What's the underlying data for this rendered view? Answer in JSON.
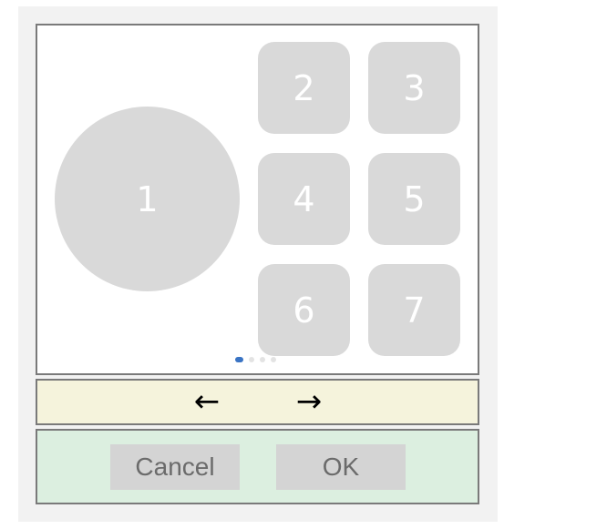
{
  "grid": {
    "circle_label": "1",
    "tiles": [
      "2",
      "3",
      "4",
      "5",
      "6",
      "7"
    ]
  },
  "pager": {
    "count": 4,
    "active_index": 0,
    "active_color": "#3a74c4"
  },
  "navigation": {
    "prev_symbol": "←",
    "next_symbol": "→",
    "prev_icon": "arrow-left-icon",
    "next_icon": "arrow-right-icon"
  },
  "actions": {
    "cancel_label": "Cancel",
    "ok_label": "OK"
  },
  "colors": {
    "nav_bar_bg": "#f5f3dc",
    "action_bar_bg": "#dcefe0",
    "item_fill": "#d9d9d9"
  }
}
